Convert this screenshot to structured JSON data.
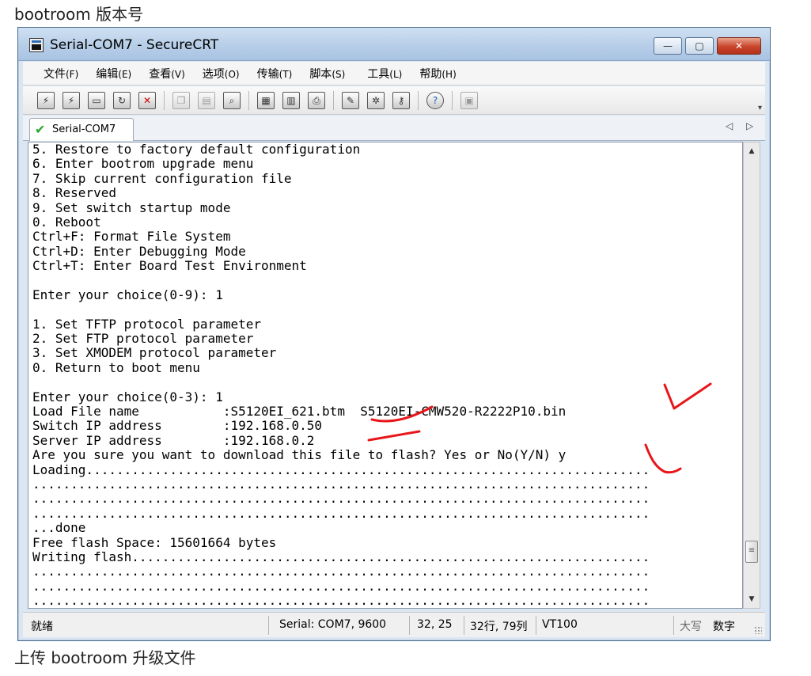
{
  "captions": {
    "top": "bootroom 版本号",
    "bottom": "上传 bootroom 升级文件"
  },
  "window": {
    "title": "Serial-COM7 - SecureCRT",
    "min_glyph": "—",
    "max_glyph": "▢",
    "close_glyph": "✕"
  },
  "menu": [
    {
      "label": "文件",
      "acc": "(F)"
    },
    {
      "label": "编辑",
      "acc": "(E)"
    },
    {
      "label": "查看",
      "acc": "(V)"
    },
    {
      "label": "选项",
      "acc": "(O)"
    },
    {
      "label": "传输",
      "acc": "(T)"
    },
    {
      "label": "脚本",
      "acc": "(S)"
    },
    {
      "label": "工具",
      "acc": "(L)"
    },
    {
      "label": "帮助",
      "acc": "(H)"
    }
  ],
  "toolbar": {
    "icons": [
      "connect-icon",
      "quick-connect-icon",
      "connect-tab-icon",
      "reconnect-icon",
      "disconnect-icon",
      "copy-icon",
      "paste-icon",
      "find-icon",
      "print-setup-icon",
      "print-icon",
      "printer-icon",
      "session-options-icon",
      "global-options-icon",
      "keymap-icon",
      "help-icon",
      "sftp-icon"
    ]
  },
  "tab": {
    "label": "Serial-COM7",
    "prev_glyph": "◁",
    "next_glyph": "▷"
  },
  "terminal": {
    "lines": [
      "5. Restore to factory default configuration",
      "6. Enter bootrom upgrade menu",
      "7. Skip current configuration file",
      "8. Reserved",
      "9. Set switch startup mode",
      "0. Reboot",
      "Ctrl+F: Format File System",
      "Ctrl+D: Enter Debugging Mode",
      "Ctrl+T: Enter Board Test Environment",
      "",
      "Enter your choice(0-9): 1",
      "",
      "1. Set TFTP protocol parameter",
      "2. Set FTP protocol parameter",
      "3. Set XMODEM protocol parameter",
      "0. Return to boot menu",
      "",
      "Enter your choice(0-3): 1",
      "Load File name           :S5120EI_621.btm  S5120EI-CMW520-R2222P10.bin",
      "Switch IP address        :192.168.0.50",
      "Server IP address        :192.168.0.2",
      "Are you sure you want to download this file to flash? Yes or No(Y/N) y",
      "Loading..........................................................................",
      ".................................................................................",
      ".................................................................................",
      ".................................................................................",
      "...done",
      "Free flash Space: 15601664 bytes",
      "Writing flash....................................................................",
      ".................................................................................",
      ".................................................................................",
      "................................................................................."
    ]
  },
  "scrollbar": {
    "up_glyph": "▲",
    "down_glyph": "▼",
    "thumb_glyph": "≡"
  },
  "status": {
    "ready": "就绪",
    "connection": "Serial: COM7, 9600",
    "cursor": "32,  25",
    "rowcol": "32行, 79列",
    "terminal_type": "VT100",
    "caps": "大写",
    "num": "数字"
  },
  "colors": {
    "annotation": "#e8161b",
    "title_gradient_top": "#cfe0f2",
    "close_button": "#c8442a"
  }
}
